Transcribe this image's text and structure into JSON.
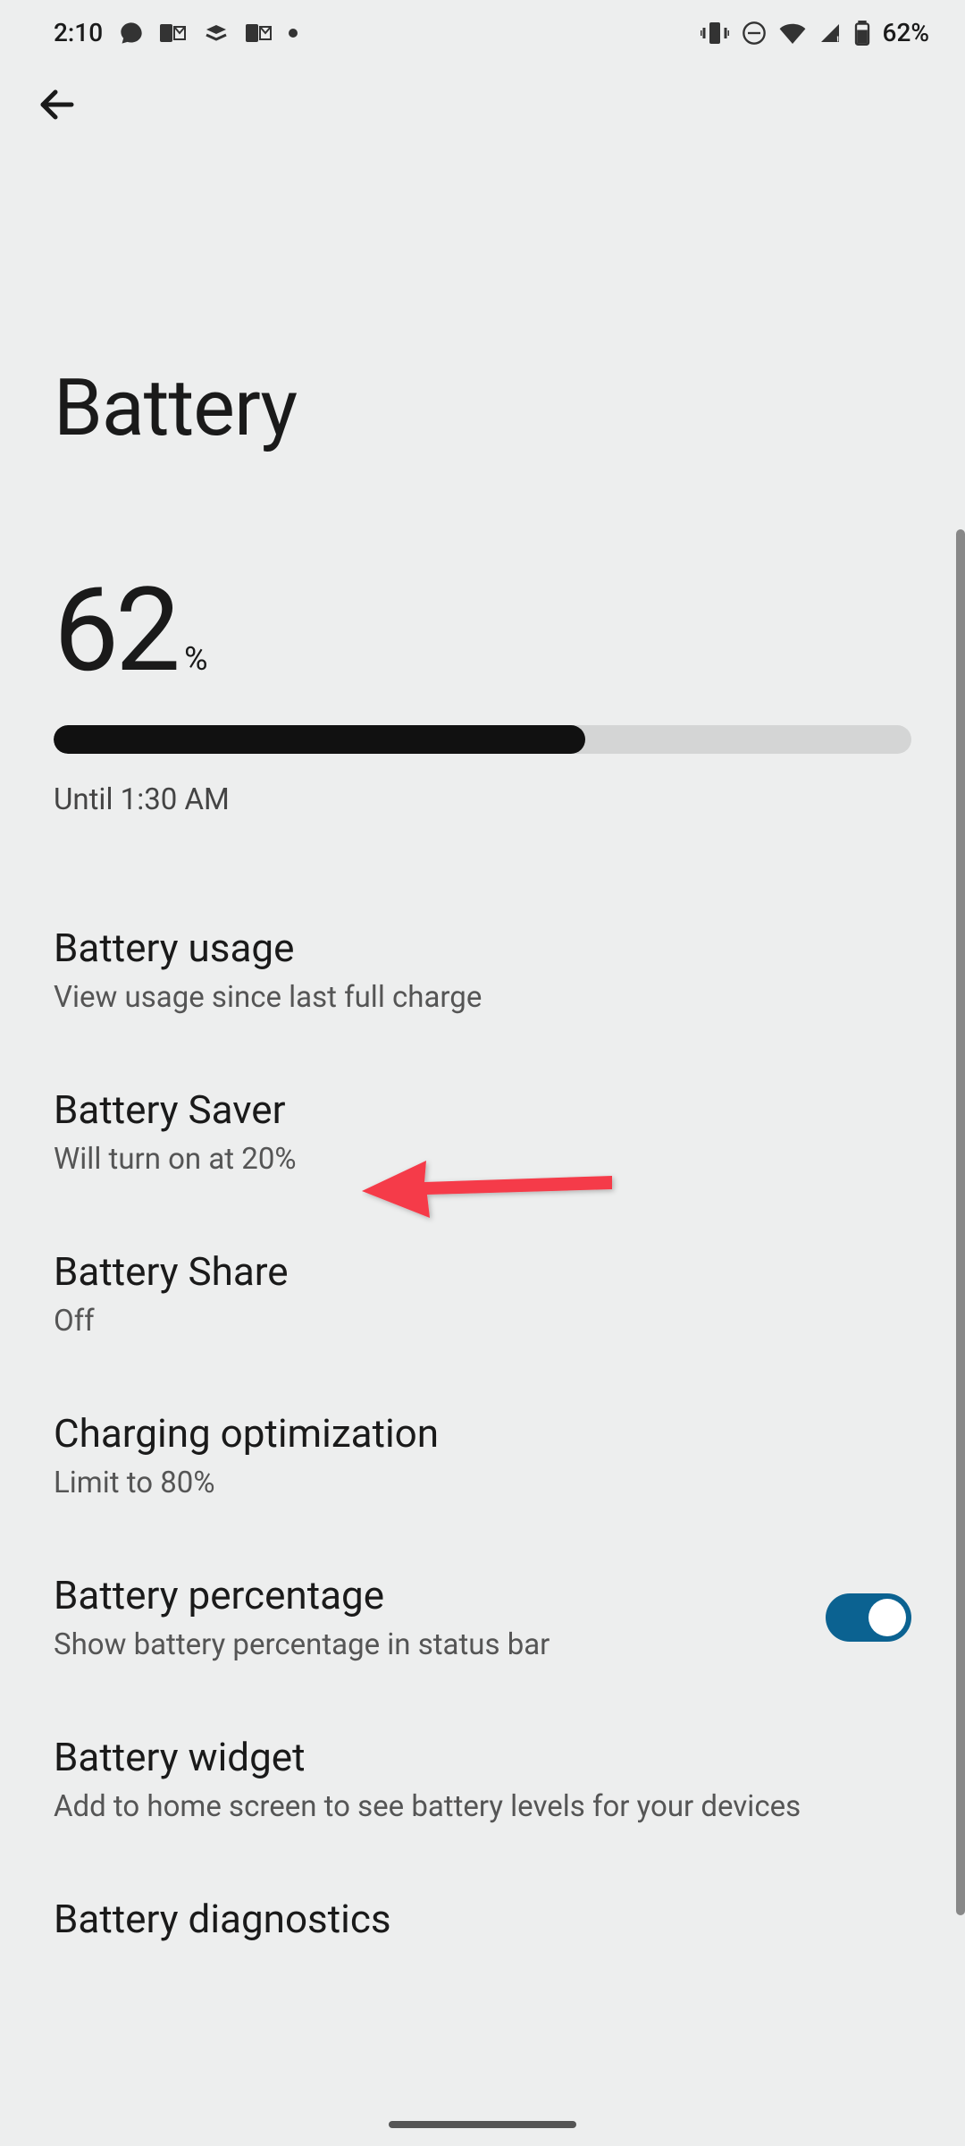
{
  "status_bar": {
    "time": "2:10",
    "battery_text": "62%"
  },
  "page": {
    "title": "Battery",
    "battery_value": "62",
    "battery_symbol": "%",
    "battery_fill_percent": 62,
    "until_text": "Until 1:30 AM"
  },
  "settings": [
    {
      "title": "Battery usage",
      "subtitle": "View usage since last full charge"
    },
    {
      "title": "Battery Saver",
      "subtitle": "Will turn on at 20%"
    },
    {
      "title": "Battery Share",
      "subtitle": "Off"
    },
    {
      "title": "Charging optimization",
      "subtitle": "Limit to 80%"
    },
    {
      "title": "Battery percentage",
      "subtitle": "Show battery percentage in status bar",
      "toggle": true
    },
    {
      "title": "Battery widget",
      "subtitle": "Add to home screen to see battery levels for your devices"
    },
    {
      "title": "Battery diagnostics",
      "subtitle": ""
    }
  ],
  "annotation": {
    "arrow_points_to": "Battery Saver"
  }
}
